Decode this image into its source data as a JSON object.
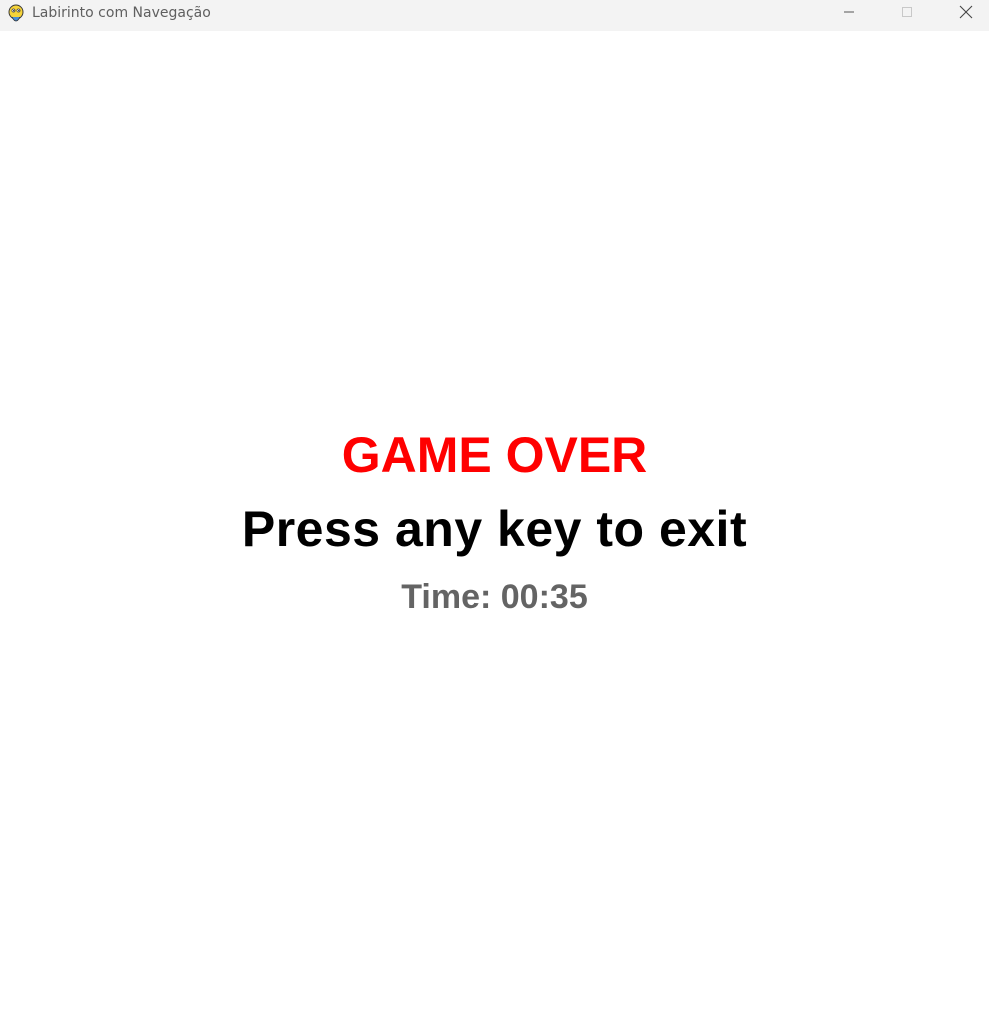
{
  "window": {
    "title": "Labirinto com Navegação",
    "icon": "pygame-snake-icon",
    "controls": {
      "minimize_icon": "minimize-icon",
      "maximize_icon": "maximize-icon",
      "close_icon": "close-icon"
    }
  },
  "game": {
    "game_over_text": "GAME OVER",
    "prompt_text": "Press any key to exit",
    "time_text": "Time: 00:35"
  },
  "colors": {
    "background": "#ffffff",
    "titlebar": "#f3f3f3",
    "game_over": "#ff0000",
    "prompt": "#000000",
    "timer": "#646464"
  }
}
